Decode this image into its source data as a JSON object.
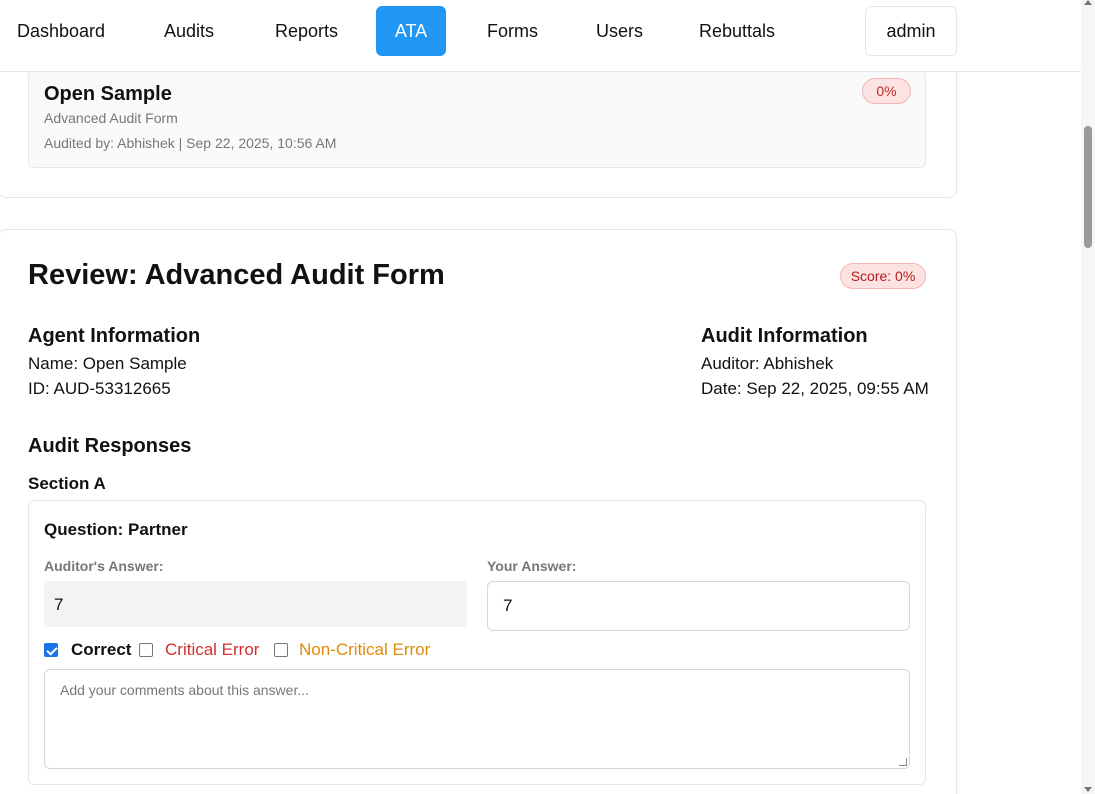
{
  "nav": {
    "items": [
      {
        "label": "Dashboard",
        "active": false
      },
      {
        "label": "Audits",
        "active": false
      },
      {
        "label": "Reports",
        "active": false
      },
      {
        "label": "ATA",
        "active": true
      },
      {
        "label": "Forms",
        "active": false
      },
      {
        "label": "Users",
        "active": false
      },
      {
        "label": "Rebuttals",
        "active": false
      }
    ],
    "user": "admin"
  },
  "sample": {
    "title": "Open Sample",
    "form": "Advanced Audit Form",
    "meta": "Audited by: Abhishek | Sep 22, 2025, 10:56 AM",
    "badge": "0%"
  },
  "review": {
    "title": "Review: Advanced Audit Form",
    "score": "Score: 0%",
    "agent": {
      "heading": "Agent Information",
      "name": "Name: Open Sample",
      "id": "ID: AUD-53312665"
    },
    "audit": {
      "heading": "Audit Information",
      "auditor": "Auditor: Abhishek",
      "date": "Date: Sep 22, 2025, 09:55 AM"
    },
    "responses_heading": "Audit Responses",
    "section": "Section A",
    "question": {
      "title": "Question: Partner",
      "auditor_answer_label": "Auditor's Answer:",
      "auditor_answer": "7",
      "your_answer_label": "Your Answer:",
      "your_answer": "7",
      "options": {
        "correct": "Correct",
        "critical": "Critical Error",
        "noncritical": "Non-Critical Error"
      },
      "comments_placeholder": "Add your comments about this answer..."
    }
  },
  "colors": {
    "accent": "#2196f3",
    "critical": "#d32f2f",
    "noncritical": "#e08a0b",
    "badge_bg": "#fde2e2"
  }
}
